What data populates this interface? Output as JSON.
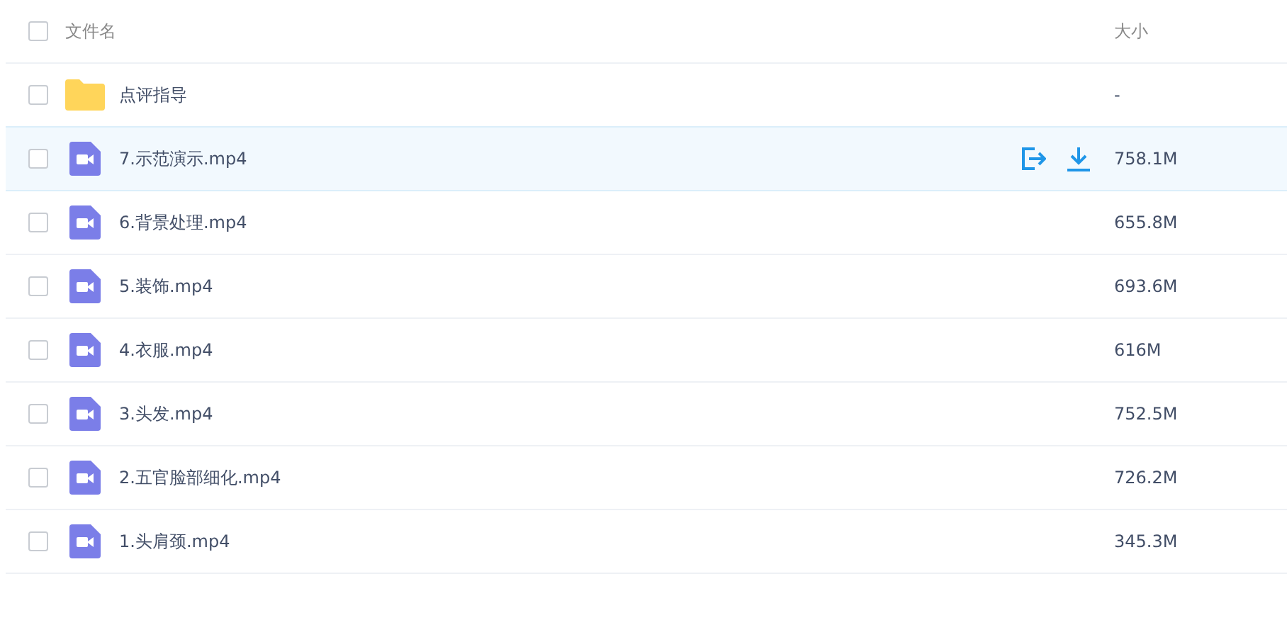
{
  "table": {
    "columns": [
      {
        "label": "文件名"
      },
      {
        "label": "大小"
      }
    ],
    "header_checked": false,
    "rows": [
      {
        "kind": "folder",
        "name": "点评指导",
        "size": "-",
        "checked": false,
        "hovered": false
      },
      {
        "kind": "video",
        "name": "7.示范演示.mp4",
        "size": "758.1M",
        "checked": false,
        "hovered": true
      },
      {
        "kind": "video",
        "name": "6.背景处理.mp4",
        "size": "655.8M",
        "checked": false,
        "hovered": false
      },
      {
        "kind": "video",
        "name": "5.装饰.mp4",
        "size": "693.6M",
        "checked": false,
        "hovered": false
      },
      {
        "kind": "video",
        "name": "4.衣服.mp4",
        "size": "616M",
        "checked": false,
        "hovered": false
      },
      {
        "kind": "video",
        "name": "3.头发.mp4",
        "size": "752.5M",
        "checked": false,
        "hovered": false
      },
      {
        "kind": "video",
        "name": "2.五官脸部细化.mp4",
        "size": "726.2M",
        "checked": false,
        "hovered": false
      },
      {
        "kind": "video",
        "name": "1.头肩颈.mp4",
        "size": "345.3M",
        "checked": false,
        "hovered": false
      }
    ]
  }
}
